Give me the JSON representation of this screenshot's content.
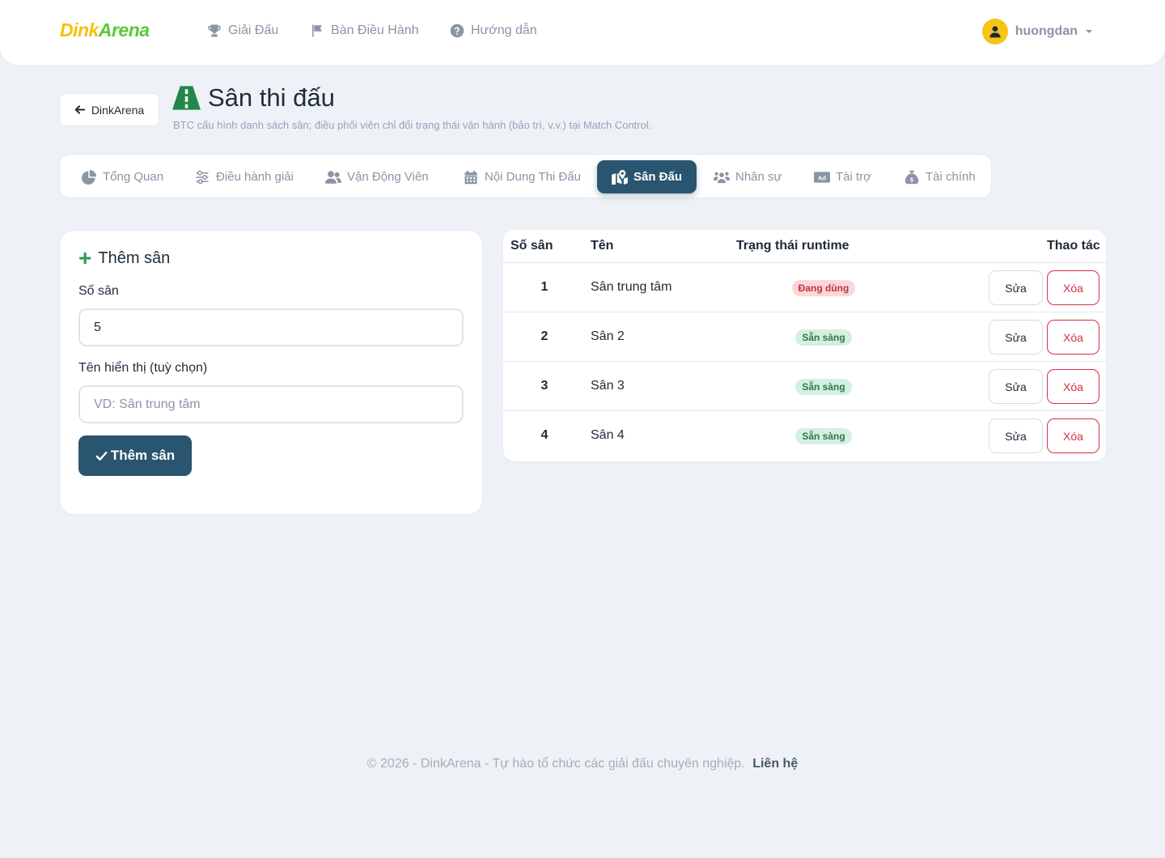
{
  "brand": {
    "part1": "Dink",
    "part2": "Arena"
  },
  "nav": {
    "items": [
      {
        "label": "Giải Đấu",
        "icon": "trophy-icon"
      },
      {
        "label": "Bàn Điều Hành",
        "icon": "flag-icon"
      },
      {
        "label": "Hướng dẫn",
        "icon": "question-circle-icon"
      }
    ],
    "user": {
      "name": "huongdan",
      "icon": "user-icon"
    }
  },
  "header": {
    "back_label": "DinkArena",
    "title": "Sân thi đấu",
    "subtitle": "BTC cấu hình danh sách sân; điều phối viên chỉ đổi trạng thái vận hành (bảo trì, v.v.) tại Match Control."
  },
  "tabs": [
    {
      "label": "Tổng Quan",
      "icon": "chart-pie-icon",
      "active": false
    },
    {
      "label": "Điều hành giải",
      "icon": "sliders-icon",
      "active": false
    },
    {
      "label": "Vận Động Viên",
      "icon": "users-icon",
      "active": false
    },
    {
      "label": "Nội Dung Thi Đấu",
      "icon": "calendar-icon",
      "active": false
    },
    {
      "label": "Sân Đấu",
      "icon": "map-location-icon",
      "active": true
    },
    {
      "label": "Nhân sự",
      "icon": "users-group-icon",
      "active": false
    },
    {
      "label": "Tài trợ",
      "icon": "ad-icon",
      "active": false
    },
    {
      "label": "Tài chính",
      "icon": "money-bag-icon",
      "active": false
    }
  ],
  "form": {
    "title": "Thêm sân",
    "court_number_label": "Số sân",
    "court_number_value": "5",
    "display_name_label": "Tên hiển thị (tuỳ chọn)",
    "display_name_placeholder": "VD: Sân trung tâm",
    "submit_label": "Thêm sân"
  },
  "table": {
    "headers": {
      "number": "Số sân",
      "name": "Tên",
      "status": "Trạng thái runtime",
      "actions": "Thao tác"
    },
    "rows": [
      {
        "number": "1",
        "name": "Sân trung tâm",
        "status": "Đang dùng",
        "status_type": "busy",
        "edit": "Sửa",
        "delete": "Xóa"
      },
      {
        "number": "2",
        "name": "Sân 2",
        "status": "Sẵn sàng",
        "status_type": "ready",
        "edit": "Sửa",
        "delete": "Xóa"
      },
      {
        "number": "3",
        "name": "Sân 3",
        "status": "Sẵn sàng",
        "status_type": "ready",
        "edit": "Sửa",
        "delete": "Xóa"
      },
      {
        "number": "4",
        "name": "Sân 4",
        "status": "Sẵn sàng",
        "status_type": "ready",
        "edit": "Sửa",
        "delete": "Xóa"
      }
    ]
  },
  "footer": {
    "text": "© 2026 - DinkArena - Tự hào tổ chức các giải đấu chuyên nghiệp.",
    "link": "Liên hệ"
  },
  "colors": {
    "primary": "#2a5570",
    "brand_yellow": "#f4c20d",
    "brand_green": "#58c93a",
    "danger": "#d6303f",
    "success": "#2a7a4c",
    "background": "#eef2f6"
  }
}
